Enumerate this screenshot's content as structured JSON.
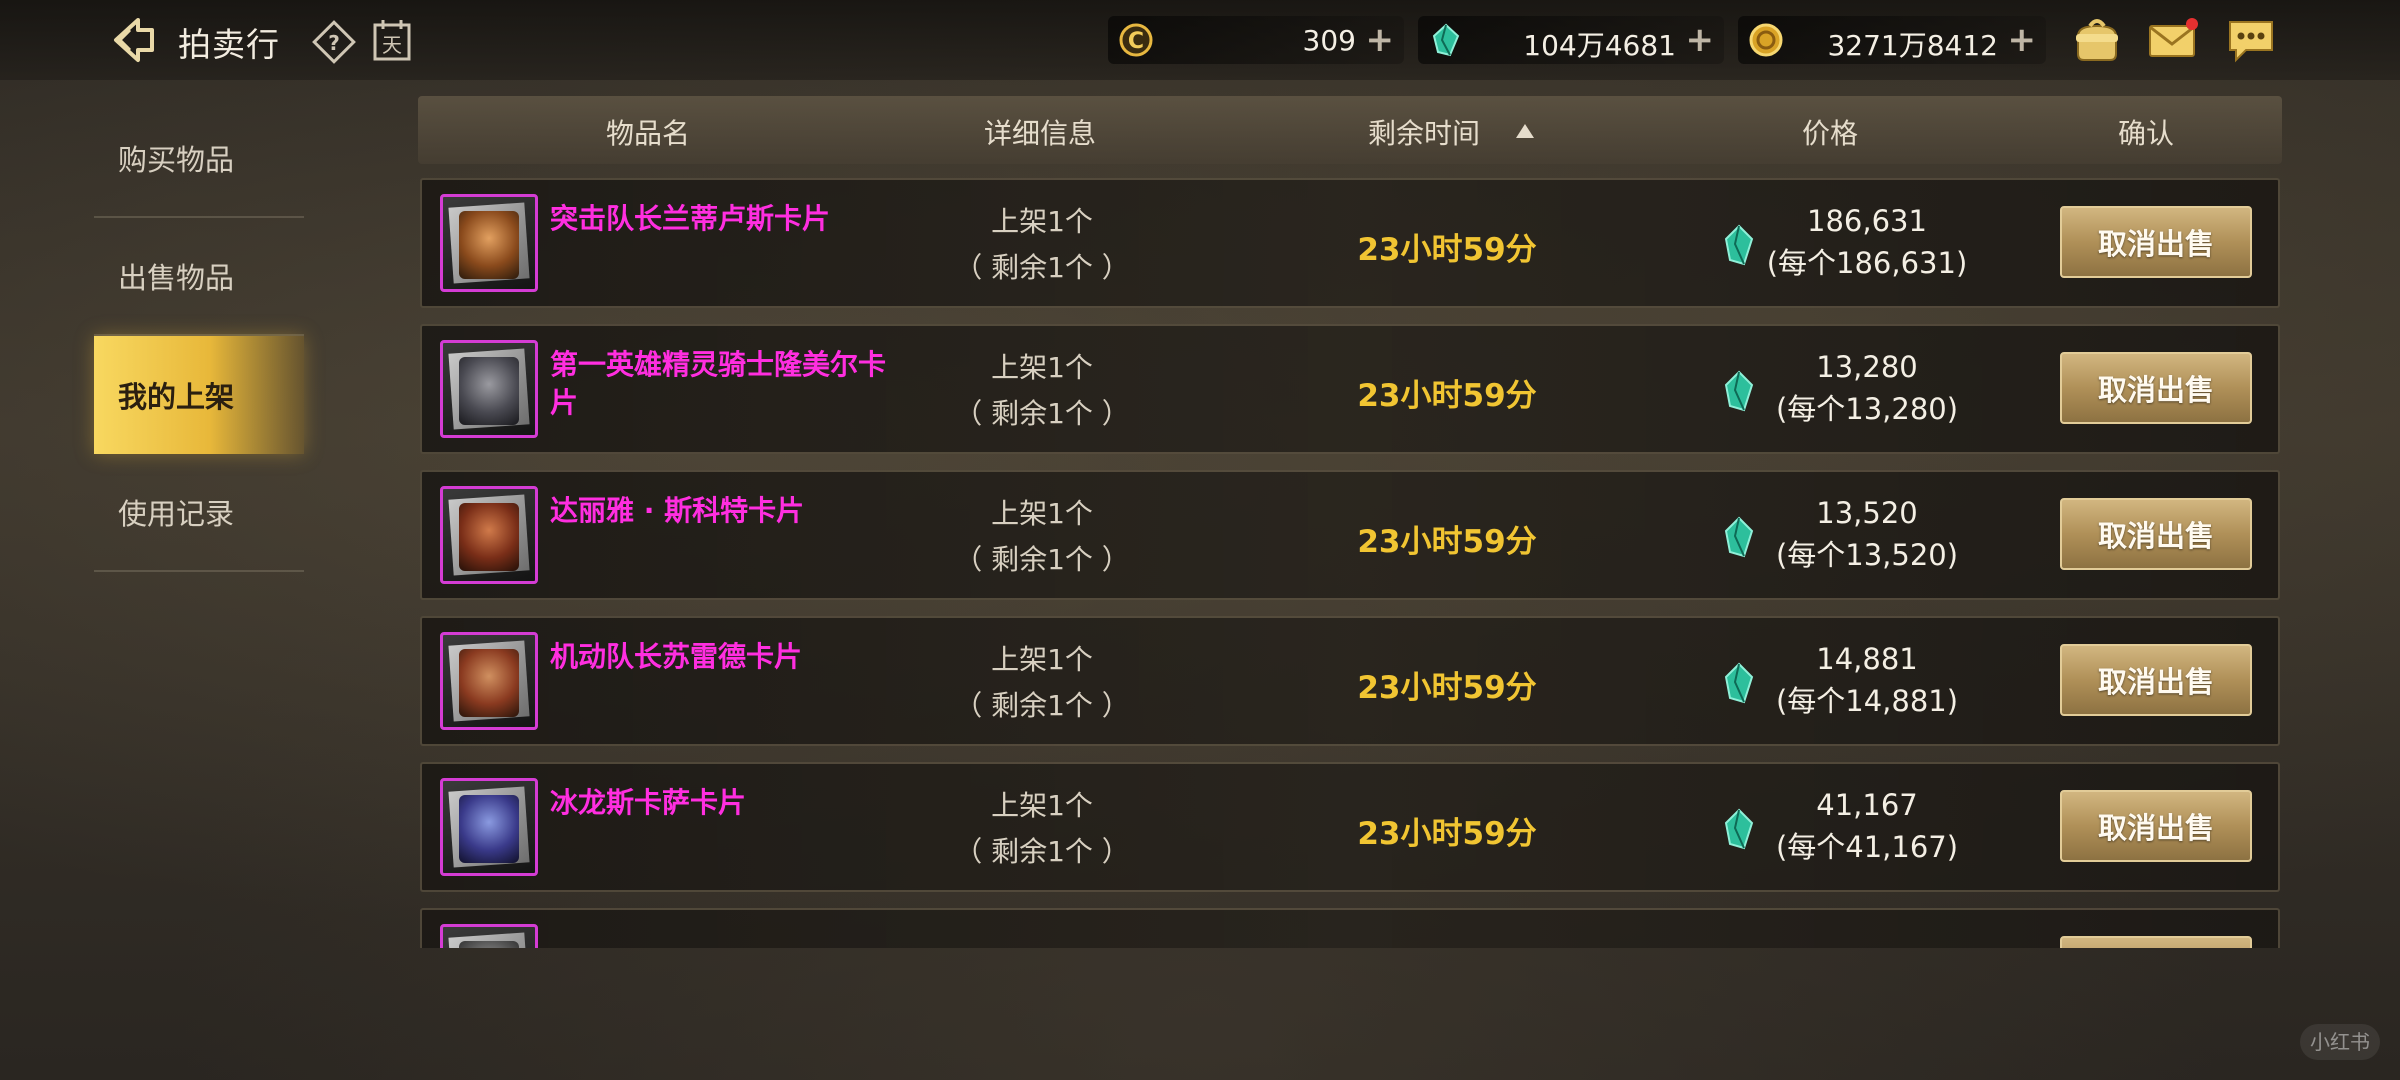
{
  "header": {
    "title": "拍卖行",
    "calendar_glyph": "天"
  },
  "currencies": [
    {
      "icon": "c-coin-icon",
      "value": "309",
      "plus": "+"
    },
    {
      "icon": "gem-icon",
      "value": "104万4681",
      "plus": "+"
    },
    {
      "icon": "gold-coin-icon",
      "value": "3271万8412",
      "plus": "+"
    }
  ],
  "sidebar": {
    "items": [
      {
        "label": "购买物品",
        "active": false
      },
      {
        "label": "出售物品",
        "active": false
      },
      {
        "label": "我的上架",
        "active": true
      },
      {
        "label": "使用记录",
        "active": false
      }
    ]
  },
  "table": {
    "columns": [
      "物品名",
      "详细信息",
      "剩余时间",
      "价格",
      "确认"
    ],
    "sort_column": "剩余时间",
    "sort_direction": "ascending",
    "rows": [
      {
        "name": "突击队长兰蒂卢斯卡片",
        "listed": "上架1个",
        "remaining": "（ 剩余1个 ）",
        "time": "23小时59分",
        "price": "186,631",
        "unit_price": "(每个186,631)",
        "action": "取消出售",
        "portrait_color": "#c8843c"
      },
      {
        "name": "第一英雄精灵骑士隆美尔卡片",
        "listed": "上架1个",
        "remaining": "（ 剩余1个 ）",
        "time": "23小时59分",
        "price": "13,280",
        "unit_price": "(每个13,280)",
        "action": "取消出售",
        "portrait_color": "#7a7a80"
      },
      {
        "name": "达丽雅 · 斯科特卡片",
        "listed": "上架1个",
        "remaining": "（ 剩余1个 ）",
        "time": "23小时59分",
        "price": "13,520",
        "unit_price": "(每个13,520)",
        "action": "取消出售",
        "portrait_color": "#a04a2a"
      },
      {
        "name": "机动队长苏雷德卡片",
        "listed": "上架1个",
        "remaining": "（ 剩余1个 ）",
        "time": "23小时59分",
        "price": "14,881",
        "unit_price": "(每个14,881)",
        "action": "取消出售",
        "portrait_color": "#a0603a"
      },
      {
        "name": "冰龙斯卡萨卡片",
        "listed": "上架1个",
        "remaining": "（ 剩余1个 ）",
        "time": "23小时59分",
        "price": "41,167",
        "unit_price": "(每个41,167)",
        "action": "取消出售",
        "portrait_color": "#4a5a9a"
      },
      {
        "name": "",
        "listed": "",
        "remaining": "",
        "time": "",
        "price": "",
        "unit_price": "",
        "action": "",
        "portrait_color": "#888888"
      }
    ]
  },
  "watermark": "小红书",
  "colors": {
    "item_name": "#ff2ee0",
    "time": "#f1c532",
    "active_tab": "#f8d860",
    "button": "#b09058"
  }
}
